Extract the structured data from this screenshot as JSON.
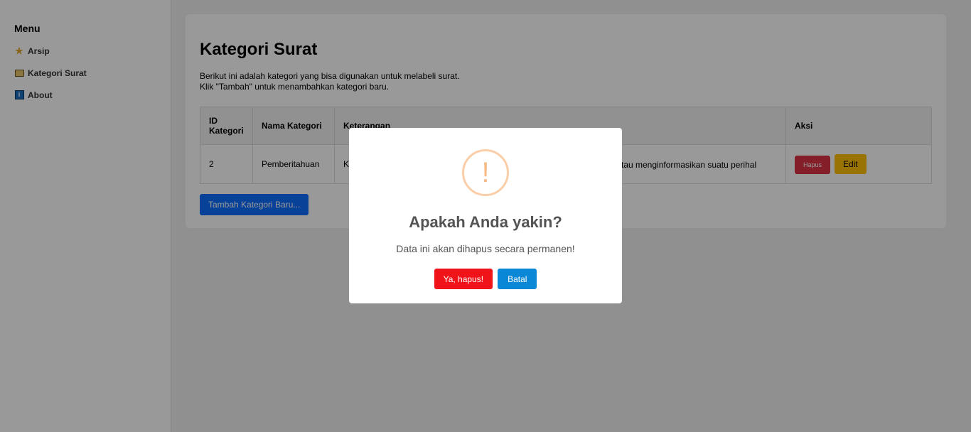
{
  "sidebar": {
    "title": "Menu",
    "items": [
      {
        "label": "Arsip",
        "icon": "star-icon"
      },
      {
        "label": "Kategori Surat",
        "icon": "folder-icon"
      },
      {
        "label": "About",
        "icon": "info-icon"
      }
    ]
  },
  "main": {
    "title": "Kategori Surat",
    "desc1": "Berikut ini adalah kategori yang bisa digunakan untuk melabeli surat.",
    "desc2": "Klik \"Tambah\" untuk menambahkan kategori baru.",
    "columns": [
      "ID Kategori",
      "Nama Kategori",
      "Keterangan",
      "Aksi"
    ],
    "rows": [
      {
        "id": "2",
        "nama": "Pemberitahuan",
        "ket_start": "K",
        "ket_end": "tau menginformasikan suatu perihal",
        "hapus": "Hapus",
        "edit": "Edit"
      }
    ],
    "add_label": "Tambah Kategori Baru..."
  },
  "dialog": {
    "icon": "warning-icon",
    "symbol": "!",
    "title": "Apakah Anda yakin?",
    "text": "Data ini akan dihapus secara permanen!",
    "confirm": "Ya, hapus!",
    "cancel": "Batal"
  },
  "colors": {
    "danger": "#dc3545",
    "warning": "#ffc107",
    "primary": "#0d6efd",
    "confirm": "#f1131a",
    "cancel": "#0a87d6"
  }
}
